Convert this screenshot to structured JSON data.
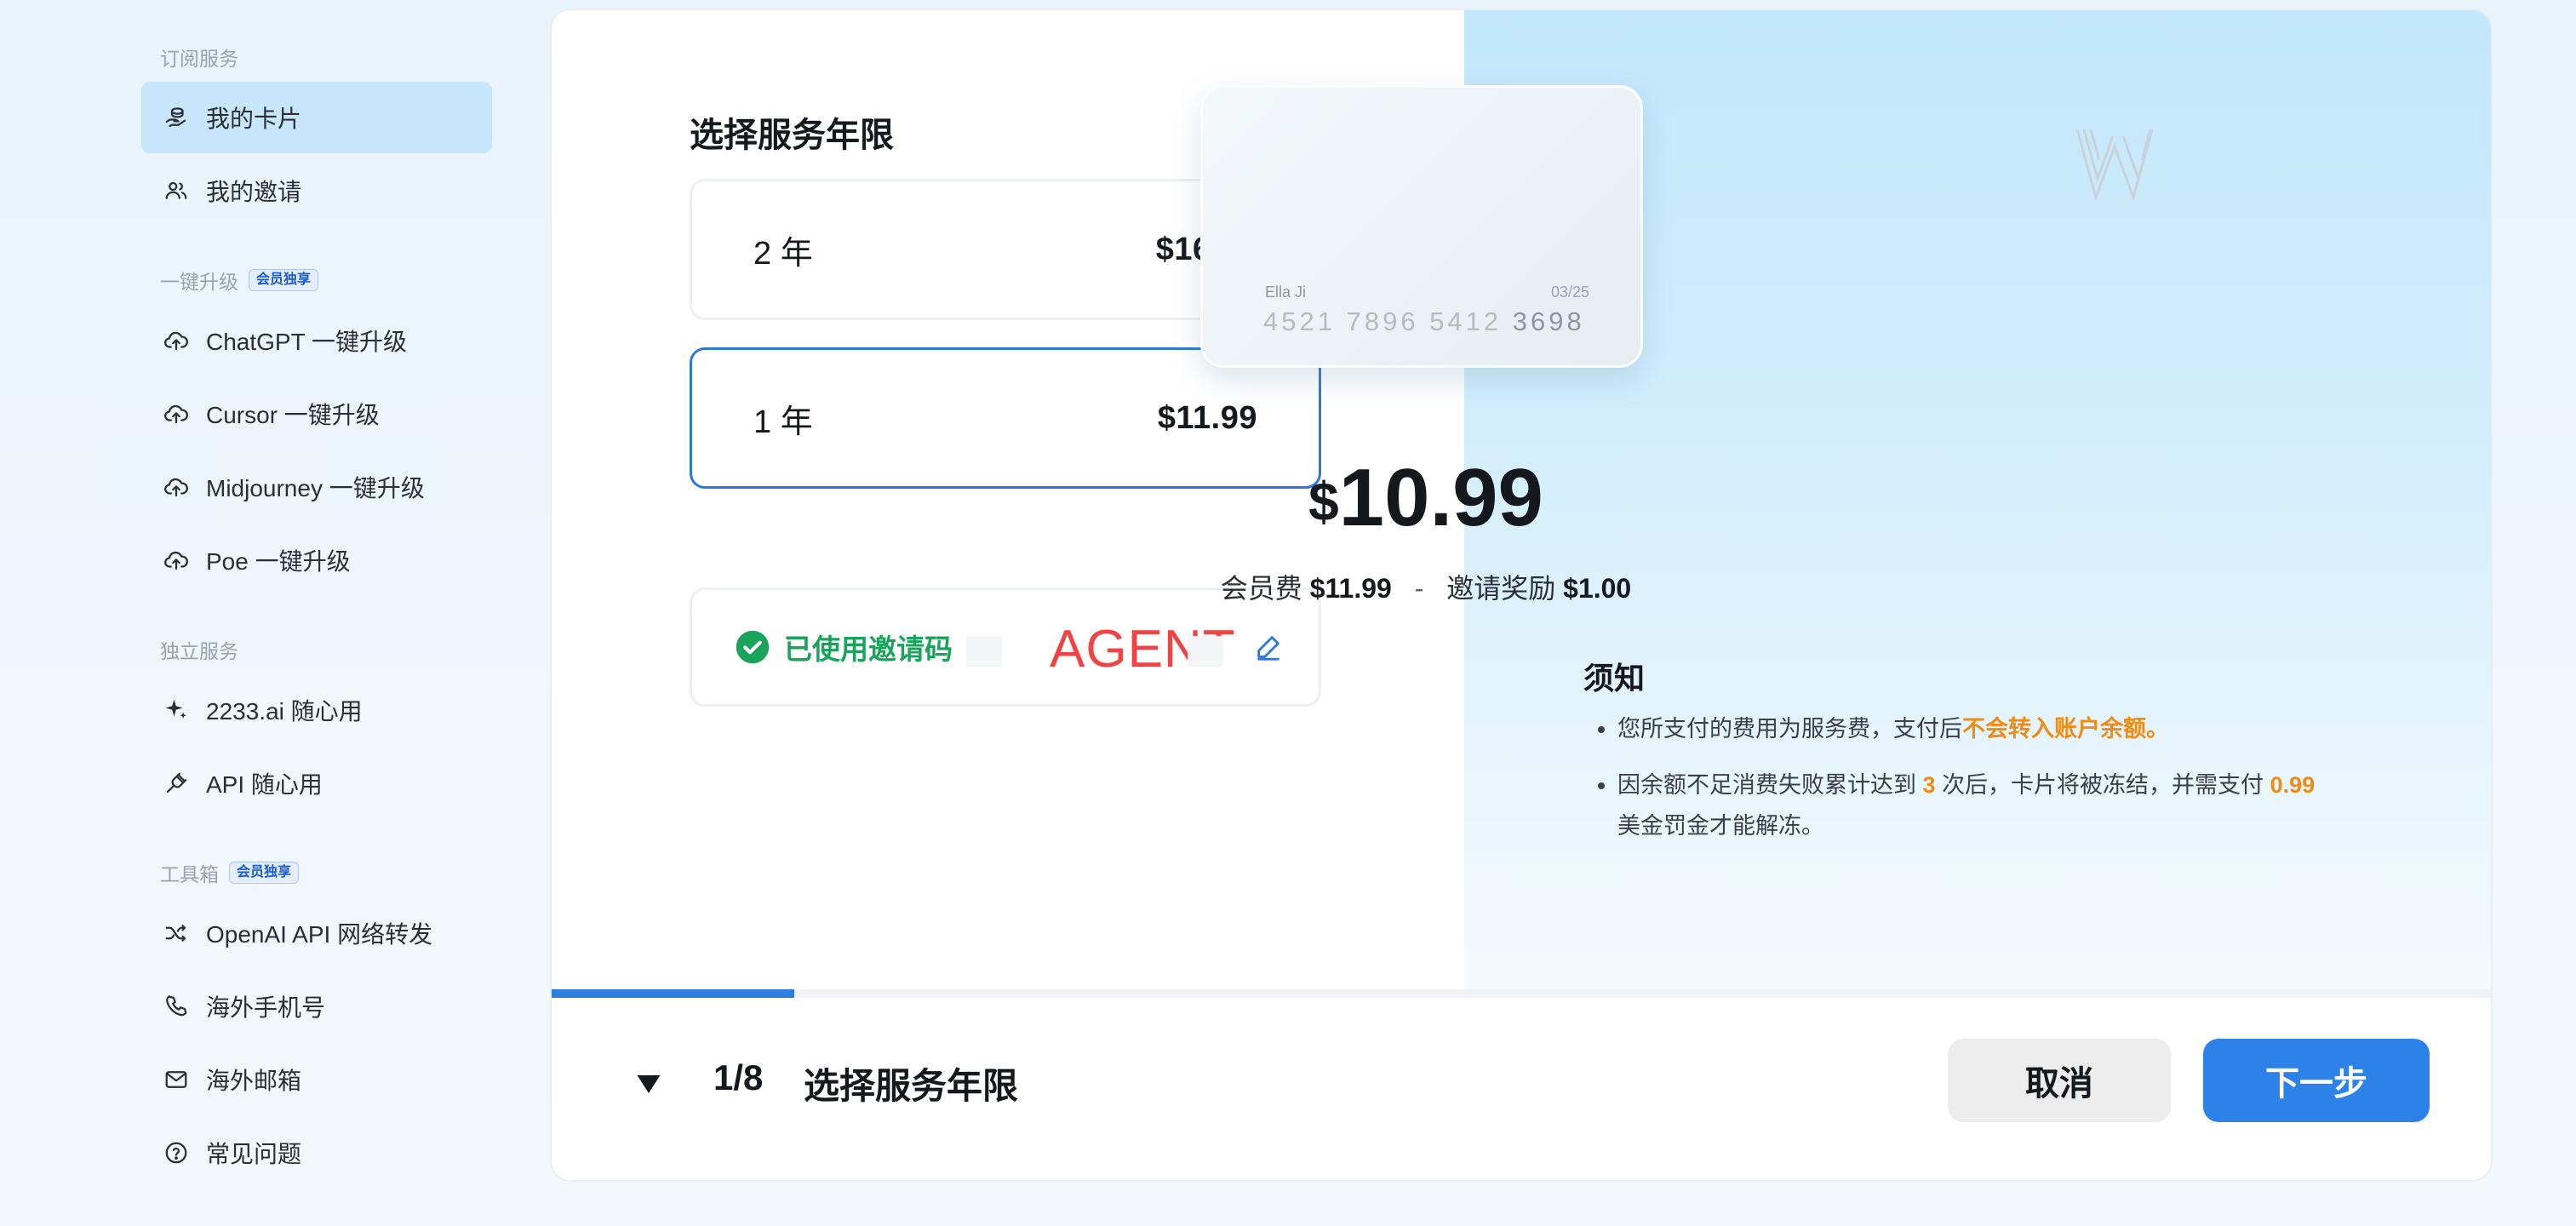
{
  "sidebar": {
    "sections": [
      {
        "title": "订阅服务",
        "badge": ""
      },
      {
        "title": "一键升级",
        "badge": "会员独享"
      },
      {
        "title": "独立服务",
        "badge": ""
      },
      {
        "title": "工具箱",
        "badge": "会员独享"
      }
    ],
    "items": [
      {
        "label": "我的卡片",
        "icon": "card-hand-icon"
      },
      {
        "label": "我的邀请",
        "icon": "users-icon"
      },
      {
        "label": "ChatGPT 一键升级",
        "icon": "cloud-upload-icon"
      },
      {
        "label": "Cursor 一键升级",
        "icon": "cloud-upload-icon"
      },
      {
        "label": "Midjourney 一键升级",
        "icon": "cloud-upload-icon"
      },
      {
        "label": "Poe 一键升级",
        "icon": "cloud-upload-icon"
      },
      {
        "label": "2233.ai 随心用",
        "icon": "sparkle-icon"
      },
      {
        "label": "API 随心用",
        "icon": "plug-icon"
      },
      {
        "label": "OpenAI API 网络转发",
        "icon": "shuffle-icon"
      },
      {
        "label": "海外手机号",
        "icon": "phone-icon"
      },
      {
        "label": "海外邮箱",
        "icon": "mail-icon"
      },
      {
        "label": "常见问题",
        "icon": "help-icon"
      }
    ],
    "active_index": 0
  },
  "plan": {
    "title": "选择服务年限",
    "options": [
      {
        "label": "2 年",
        "price": "$16.99",
        "selected": false
      },
      {
        "label": "1 年",
        "price": "$11.99",
        "selected": true
      }
    ],
    "invite_label": "已使用邀请码",
    "invite_code": "AGENT"
  },
  "card": {
    "holder": "Ella Ji",
    "expiry": "03/25",
    "number": [
      "4521",
      "7896",
      "5412",
      "3698"
    ]
  },
  "summary": {
    "currency": "$",
    "total": "10.99",
    "fee_label": "会员费",
    "fee": "$11.99",
    "separator": "-",
    "reward_label": "邀请奖励",
    "reward": "$1.00"
  },
  "notice": {
    "title": "须知",
    "item1_prefix": "您所支付的费用为服务费，支付后",
    "item1_highlight": "不会转入账户余额。",
    "item2_prefix": "因余额不足消费失败累计达到",
    "item2_count": "3",
    "item2_mid": "次后，卡片将被冻结，并需支付",
    "item2_amount": "0.99",
    "item2_suffix": "美金罚金才能解冻。"
  },
  "progress": {
    "current": 1,
    "total": 8,
    "fraction": 0.125
  },
  "footer": {
    "step_count": "1/8",
    "step_title": "选择服务年限",
    "cancel_label": "取消",
    "next_label": "下一步"
  },
  "colors": {
    "accent": "#2c82e8",
    "success": "#1aa35a",
    "highlight": "#f08c14",
    "active_nav": "#c7e6fb"
  }
}
